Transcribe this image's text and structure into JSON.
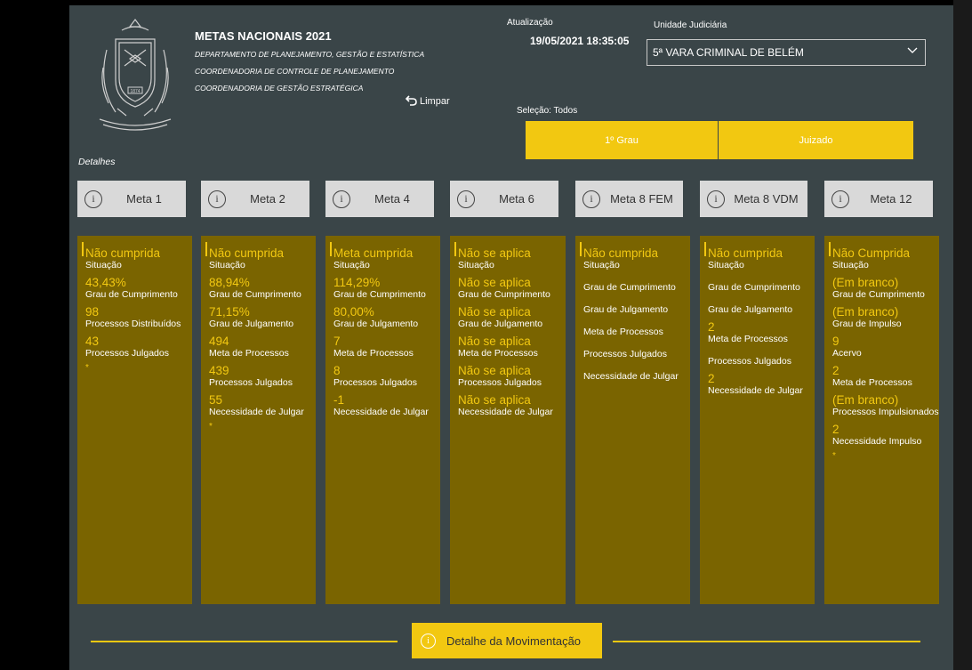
{
  "header": {
    "title": "METAS NACIONAIS 2021",
    "subtitles": [
      "DEPARTAMENTO DE PLANEJAMENTO, GESTÃO E ESTATÍSTICA",
      "COORDENADORIA DE CONTROLE DE PLANEJAMENTO",
      "COORDENADORIA DE GESTÃO ESTRATÉGICA"
    ],
    "logo_year": "1874",
    "limpar_label": "Limpar",
    "update_label": "Atualização",
    "update_value": "19/05/2021 18:35:05",
    "unit_label": "Unidade Judiciária",
    "unit_value": "5ª VARA CRIMINAL DE BELÉM",
    "selection_label": "Seleção: Todos",
    "grau_buttons": [
      "1º Grau",
      "Juizado"
    ]
  },
  "details_label": "Detalhes",
  "metas": [
    {
      "label": "Meta 1",
      "rows": [
        {
          "v": "Não cumprida",
          "l": "Situação"
        },
        {
          "v": "43,43%",
          "l": "Grau de Cumprimento"
        },
        {
          "v": "98",
          "l": "Processos Distribuídos"
        },
        {
          "v": "43",
          "l": "Processos Julgados"
        }
      ],
      "dot": "*"
    },
    {
      "label": "Meta 2",
      "rows": [
        {
          "v": "Não cumprida",
          "l": "Situação"
        },
        {
          "v": "88,94%",
          "l": "Grau de Cumprimento"
        },
        {
          "v": "71,15%",
          "l": "Grau de Julgamento"
        },
        {
          "v": "494",
          "l": "Meta de Processos"
        },
        {
          "v": "439",
          "l": "Processos Julgados"
        },
        {
          "v": "55",
          "l": "Necessidade de Julgar"
        }
      ],
      "dot": "*"
    },
    {
      "label": "Meta 4",
      "rows": [
        {
          "v": "Meta cumprida",
          "l": "Situação"
        },
        {
          "v": "114,29%",
          "l": "Grau de Cumprimento"
        },
        {
          "v": "80,00%",
          "l": "Grau de Julgamento"
        },
        {
          "v": "7",
          "l": "Meta de Processos"
        },
        {
          "v": "8",
          "l": "Processos Julgados"
        },
        {
          "v": "-1",
          "l": "Necessidade de Julgar"
        }
      ],
      "dot": ""
    },
    {
      "label": "Meta 6",
      "rows": [
        {
          "v": "Não se aplica",
          "l": "Situação"
        },
        {
          "v": "Não se aplica",
          "l": "Grau de Cumprimento"
        },
        {
          "v": "Não se aplica",
          "l": "Grau de Julgamento"
        },
        {
          "v": "Não se aplica",
          "l": "Meta de Processos"
        },
        {
          "v": "Não se aplica",
          "l": "Processos Julgados"
        },
        {
          "v": "Não se aplica",
          "l": "Necessidade de Julgar"
        }
      ],
      "dot": ""
    },
    {
      "label": "Meta 8 FEM",
      "rows": [
        {
          "v": "Não cumprida",
          "l": "Situação"
        },
        {
          "v": "",
          "l": "Grau de Cumprimento"
        },
        {
          "v": "",
          "l": "Grau de Julgamento"
        },
        {
          "v": "",
          "l": "Meta de Processos"
        },
        {
          "v": "",
          "l": "Processos Julgados"
        },
        {
          "v": "",
          "l": "Necessidade de Julgar"
        }
      ],
      "dot": ""
    },
    {
      "label": "Meta 8 VDM",
      "rows": [
        {
          "v": "Não cumprida",
          "l": "Situação"
        },
        {
          "v": "",
          "l": "Grau de Cumprimento"
        },
        {
          "v": "",
          "l": "Grau de Julgamento"
        },
        {
          "v": "2",
          "l": "Meta de Processos"
        },
        {
          "v": "",
          "l": "Processos Julgados"
        },
        {
          "v": "2",
          "l": "Necessidade de Julgar"
        }
      ],
      "dot": ""
    },
    {
      "label": "Meta 12",
      "rows": [
        {
          "v": "Não Cumprida",
          "l": "Situação"
        },
        {
          "v": "(Em branco)",
          "l": "Grau de Cumprimento"
        },
        {
          "v": "(Em branco)",
          "l": "Grau de Impulso"
        },
        {
          "v": "9",
          "l": "Acervo"
        },
        {
          "v": "2",
          "l": "Meta de Processos"
        },
        {
          "v": "(Em branco)",
          "l": "Processos Impulsionados"
        },
        {
          "v": "2",
          "l": "Necessidade Impulso"
        }
      ],
      "dot": "*"
    }
  ],
  "footer": {
    "button_label": "Detalhe da Movimentação"
  },
  "colors": {
    "background": "#3a4548",
    "accent": "#f2c811",
    "card": "#7a6400",
    "button": "#d9d9d9"
  },
  "icons": {
    "info": "info-icon",
    "undo": "undo-arrow-icon",
    "dropdown": "chevron-down-icon"
  }
}
